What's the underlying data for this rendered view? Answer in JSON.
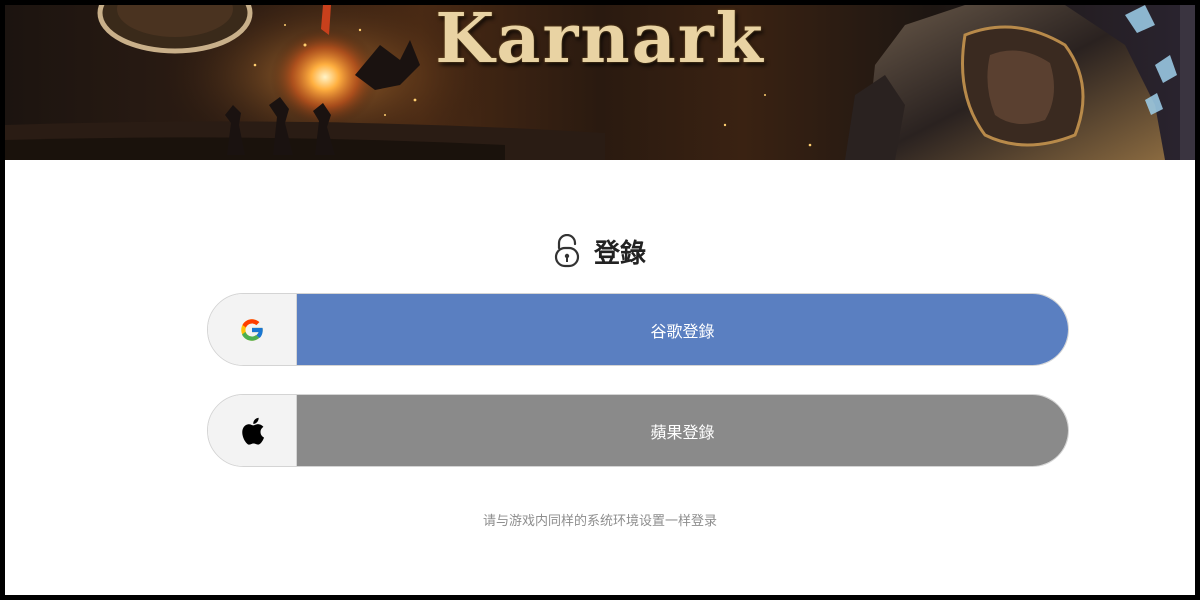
{
  "banner": {
    "logo_text": "Karnark",
    "image": "fantasy-battle-banner"
  },
  "login": {
    "title": "登錄",
    "icon": "lock-open-icon"
  },
  "buttons": {
    "google": {
      "label": "谷歌登錄",
      "icon": "google-icon",
      "color": "#5a7fc1"
    },
    "apple": {
      "label": "蘋果登錄",
      "icon": "apple-icon",
      "color": "#8a8a8a"
    }
  },
  "note": "请与游戏内同样的系统环境设置一样登录"
}
